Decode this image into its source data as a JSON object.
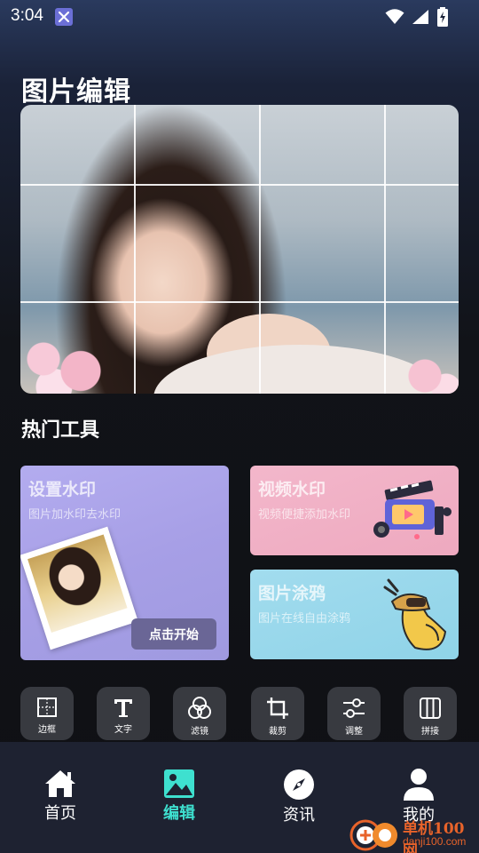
{
  "status_bar": {
    "time": "3:04",
    "icons": [
      "app-notification-icon",
      "wifi-icon",
      "signal-icon",
      "battery-charging-icon"
    ]
  },
  "page": {
    "title": "图片编辑"
  },
  "hero": {
    "grid_icon": "crop-grid-overlay"
  },
  "hot_tools": {
    "title": "热门工具",
    "cards": [
      {
        "title": "设置水印",
        "subtitle": "图片加水印去水印",
        "button": "点击开始",
        "color": "#a9a1e8"
      },
      {
        "title": "视频水印",
        "subtitle": "视频便捷添加水印",
        "color": "#f1b0c5"
      },
      {
        "title": "图片涂鸦",
        "subtitle": "图片在线自由涂鸦",
        "color": "#99d8ec"
      }
    ]
  },
  "tools": [
    {
      "label": "边框",
      "icon": "border-icon"
    },
    {
      "label": "文字",
      "icon": "text-icon"
    },
    {
      "label": "滤镜",
      "icon": "filter-icon"
    },
    {
      "label": "裁剪",
      "icon": "crop-icon"
    },
    {
      "label": "调整",
      "icon": "adjust-icon"
    },
    {
      "label": "拼接",
      "icon": "collage-icon"
    }
  ],
  "nav": {
    "items": [
      {
        "label": "首页",
        "icon": "home-icon",
        "active": false
      },
      {
        "label": "编辑",
        "icon": "image-edit-icon",
        "active": true
      },
      {
        "label": "资讯",
        "icon": "compass-icon",
        "active": false
      },
      {
        "label": "我的",
        "icon": "user-icon",
        "active": false
      }
    ],
    "active_color": "#3ee0cf"
  },
  "watermark": {
    "line1": "单机100网",
    "line2": "danji100.com"
  }
}
